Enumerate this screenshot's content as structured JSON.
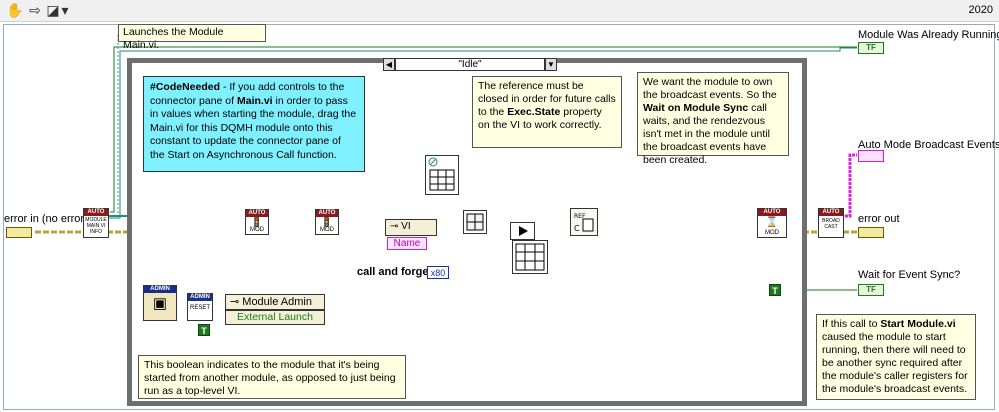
{
  "header": {
    "year": "2020"
  },
  "notes": {
    "launch": "Launches the Module Main.vi.",
    "code_needed_title": "#CodeNeeded",
    "code_needed_a": " - If you add controls to the connector pane of ",
    "code_needed_b": "Main.vi",
    "code_needed_c": " in order to pass in values when starting the module, drag the Main.vi for this DQMH module onto this constant to update the connector pane of the Start on Asynchronous Call function.",
    "reference_a": "The reference must be closed in order for future calls to the ",
    "reference_b": "Exec.State",
    "reference_c": " property on the VI to work correctly.",
    "broadcast_a": "We want the module to own the broadcast events. So the ",
    "broadcast_b": "Wait on Module Sync",
    "broadcast_c": " call waits, and the rendezvous isn't met in the module until the broadcast events have been created.",
    "boolean_note": "This boolean indicates to the module that it's being started from another module, as opposed to just being run as a top-level VI.",
    "start_a": "If this call to ",
    "start_b": "Start Module.vi",
    "start_c": " caused the module to start running, then there will need to be another sync required after the module's caller registers for the module's broadcast events."
  },
  "case_selector": {
    "value": "\"Idle\""
  },
  "terminals": {
    "error_in": "error in (no error)",
    "module_running": "Module Was Already Running?",
    "auto_mode": "Auto Mode Broadcast Events",
    "error_out": "error out",
    "wait_sync": "Wait for Event Sync?"
  },
  "nodes": {
    "vi_prop": "VI",
    "name_prop": "Name",
    "module_admin": "Module Admin",
    "external_launch": "External Launch",
    "call_forget": "call and forget",
    "x80": "x80",
    "tf": "TF",
    "t": "T",
    "auto": "AUTO",
    "admin": "ADMIN",
    "reset": "RESET",
    "module_main_vi_info": "MODULE MAIN VI INFO",
    "mod": "MOD",
    "broadcast": "BROAD CAST"
  },
  "colors": {
    "error_wire": "#b5a33a",
    "ref_wire": "#1f8a8a",
    "bool_wire": "#1f7a1f",
    "pink_wire": "#e020e0",
    "blue_wire": "#3355cc",
    "note_bg": "#ffffe1",
    "cyan_note_bg": "#7ff0ff"
  }
}
